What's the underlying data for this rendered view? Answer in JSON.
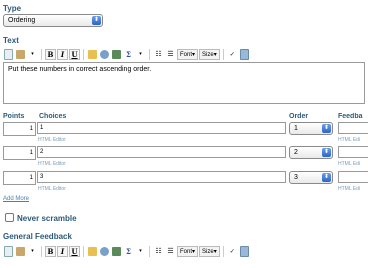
{
  "type_section": {
    "label": "Type",
    "selected": "Ordering"
  },
  "text_section": {
    "label": "Text",
    "content": "Put these numbers in correct ascending order."
  },
  "toolbar": {
    "bold": "B",
    "italic": "I",
    "underline": "U",
    "font_label": "Font",
    "size_label": "Size",
    "sigma": "Σ"
  },
  "choices_table": {
    "headers": {
      "points": "Points",
      "choices": "Choices",
      "order": "Order",
      "feedback": "Feedba"
    },
    "rows": [
      {
        "points": "1",
        "choice": "1",
        "editor_link": "HTML Editor",
        "order": "1",
        "feedback_link": "HTML Edi"
      },
      {
        "points": "1",
        "choice": "2",
        "editor_link": "HTML Editor",
        "order": "2",
        "feedback_link": "HTML Edi"
      },
      {
        "points": "1",
        "choice": "3",
        "editor_link": "HTML Editor",
        "order": "3",
        "feedback_link": "HTML Edi"
      }
    ],
    "add_more": "Add More"
  },
  "never_scramble": {
    "label": "Never scramble",
    "checked": false
  },
  "general_feedback": {
    "label": "General Feedback"
  }
}
